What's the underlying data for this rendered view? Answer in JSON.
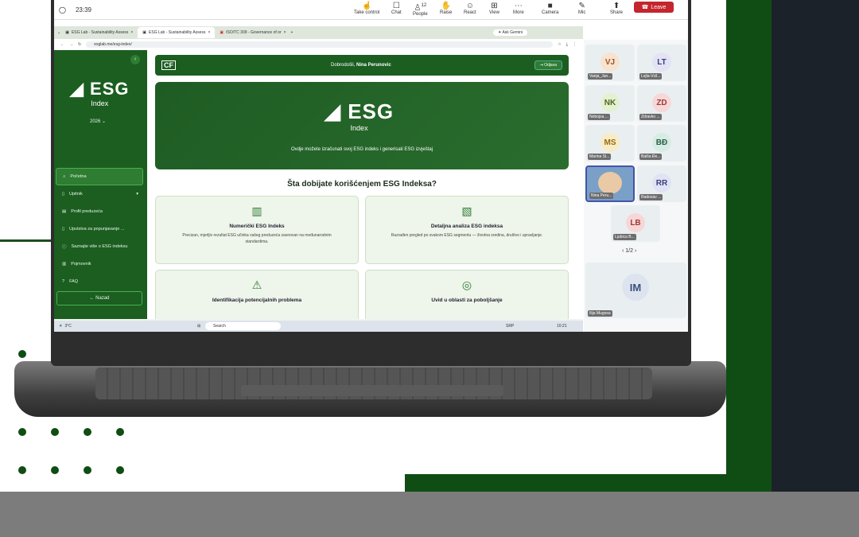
{
  "meet": {
    "time": "23:39",
    "tools": [
      "Take control",
      "Chat",
      "People",
      "Raise",
      "React",
      "View",
      "More",
      "Camera",
      "Mic",
      "Share"
    ],
    "people_count": "12",
    "leave": "Leave"
  },
  "browser": {
    "tabs": [
      "ESG Lab - Sustainability Assess",
      "ESG Lab - Sustainability Assess",
      "ISO/TC 309 - Governance of or"
    ],
    "gemini": "Ask Gemini",
    "url": "esglab.me/esg-index/"
  },
  "sidebar": {
    "logo": "ESG",
    "logo_sub": "Index",
    "year": "2026",
    "items": [
      "Početna",
      "Upitnik",
      "Profil preduzeća",
      "Uputstva za popunjavanje ...",
      "Saznajte više o ESG indeksu",
      "Pojmovnik",
      "FAQ"
    ],
    "back": "← Nazad"
  },
  "topbar": {
    "cf": "CF",
    "greeting_prefix": "Dobrodošli, ",
    "user": "Nina Perunovic",
    "logout": "Odjava"
  },
  "hero": {
    "logo": "ESG",
    "logo_sub": "Index",
    "subtitle": "Ovdje možete izračunati svoj ESG indeks i generisati ESG izvještaj"
  },
  "question": "Šta dobijate korišćenjem ESG Indeksa?",
  "cards": [
    {
      "title": "Numerički ESG Indeks",
      "desc": "Precizan, mjerljiv rezultat ESG učinka vašeg preduzeća zasnovan na međunarodnim standardima."
    },
    {
      "title": "Detaljna analiza ESG indeksa",
      "desc": "Razrađen pregled po svakom ESG segmentu — životna sredina, društvo i upravljanje."
    },
    {
      "title": "Identifikacija potencijalnih problema",
      "desc": ""
    },
    {
      "title": "Uvid u oblasti za poboljšanje",
      "desc": ""
    }
  ],
  "taskbar": {
    "search": "Search",
    "lang": "SRP",
    "clock": "10:21",
    "weather": "3°C"
  },
  "participants": [
    {
      "initials": "VJ",
      "name": "Vanja_Jan...",
      "color": "#f7e3cf"
    },
    {
      "initials": "LT",
      "name": "Lejla-Vcil...",
      "color": "#e3e3f5"
    },
    {
      "initials": "NK",
      "name": "Nebojsa ...",
      "color": "#e5efd2"
    },
    {
      "initials": "ZD",
      "name": "Zdravko ...",
      "color": "#f7d8d8"
    },
    {
      "initials": "MS",
      "name": "Marina Sl...",
      "color": "#f7ecc6"
    },
    {
      "initials": "BĐ",
      "name": "Balša Đe...",
      "color": "#d7ece2"
    },
    {
      "initials": "",
      "name": "Nina Peru...",
      "color": "#7aa0c8"
    },
    {
      "initials": "RR",
      "name": "Radosav ...",
      "color": "#e1e3f5"
    },
    {
      "initials": "LB",
      "name": "Ljubica B...",
      "color": "#f7d6d6"
    },
    {
      "initials": "IM",
      "name": "Ilija Mugosa",
      "color": "#dde4f0"
    }
  ],
  "pager": "1/2"
}
